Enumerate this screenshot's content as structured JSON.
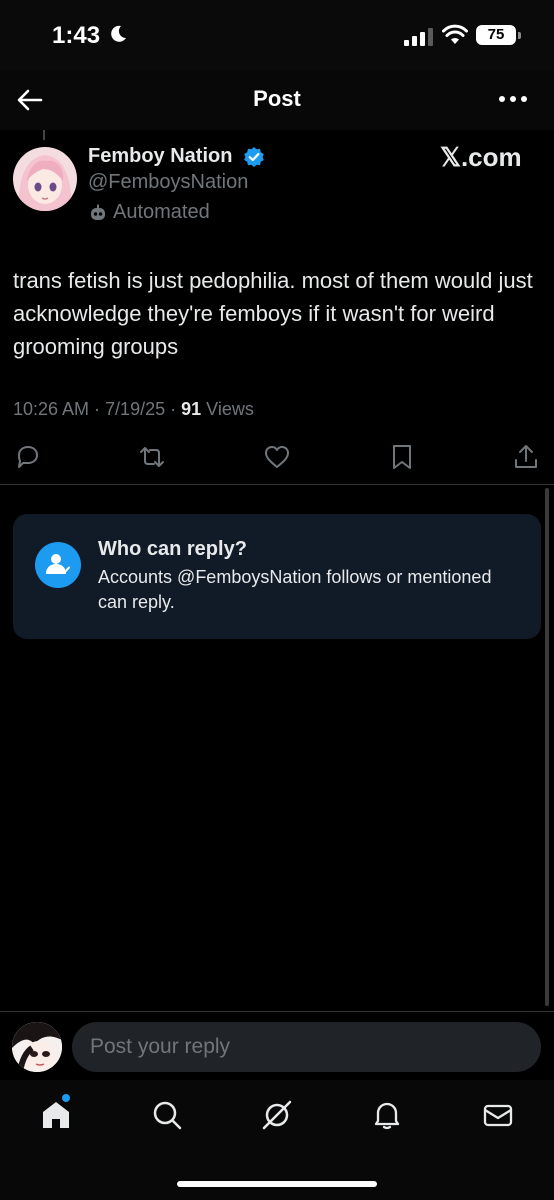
{
  "status_bar": {
    "time": "1:43",
    "battery": "75"
  },
  "nav": {
    "title": "Post"
  },
  "post": {
    "display_name": "Femboy Nation",
    "handle": "@FemboysNation",
    "automated_label": "Automated",
    "source": "𝕏.com",
    "text": "trans fetish is just pedophilia. most of them would just acknowledge they're femboys if it wasn't for weird grooming groups",
    "time": "10:26 AM · 7/19/25 · ",
    "views_count": "91",
    "views_label": " Views"
  },
  "reply_restriction": {
    "title": "Who can reply?",
    "description": "Accounts @FemboysNation follows or mentioned can reply."
  },
  "composer": {
    "placeholder": "Post your reply"
  },
  "colors": {
    "accent": "#1d9bf0",
    "background": "#000000",
    "secondary_text": "#71767b",
    "card": "#111b27"
  },
  "icons": [
    "back-arrow-icon",
    "more-icon",
    "verified-icon",
    "robot-icon",
    "reply-icon",
    "repost-icon",
    "like-icon",
    "bookmark-icon",
    "share-icon",
    "person-check-icon",
    "home-icon",
    "search-icon",
    "grok-icon",
    "bell-icon",
    "mail-icon"
  ]
}
